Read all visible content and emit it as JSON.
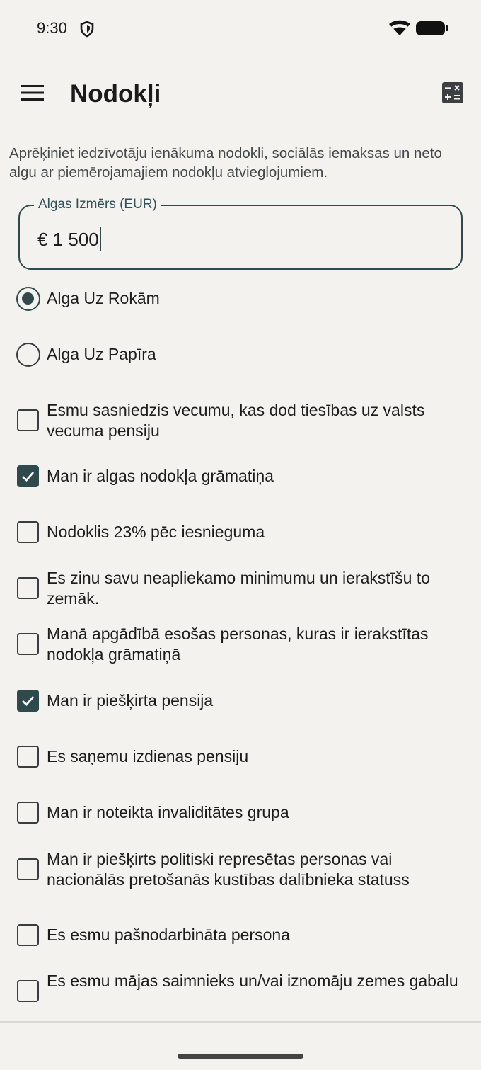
{
  "status_bar": {
    "time": "9:30"
  },
  "app_bar": {
    "title": "Nodokļi"
  },
  "description": "Aprēķiniet iedzīvotāju ienākuma nodokli, sociālās iemaksas un neto algu ar piemērojamajiem nodokļu atvieglojumiem.",
  "salary_field": {
    "label": "Algas Izmērs (EUR)",
    "value": "€ 1 500"
  },
  "radio_options": [
    {
      "label": "Alga Uz Rokām",
      "selected": true
    },
    {
      "label": "Alga Uz Papīra",
      "selected": false
    }
  ],
  "checkbox_options": [
    {
      "label": "Esmu sasniedzis vecumu, kas dod tiesības uz valsts vecuma pensiju",
      "checked": false
    },
    {
      "label": "Man ir algas nodokļa grāmatiņa",
      "checked": true
    },
    {
      "label": "Nodoklis 23% pēc iesnieguma",
      "checked": false
    },
    {
      "label": "Es zinu savu neapliekamo minimumu un ierakstīšu to zemāk.",
      "checked": false
    },
    {
      "label": "Manā apgādībā esošas personas, kuras ir ierakstītas nodokļa grāmatiņā",
      "checked": false
    },
    {
      "label": "Man ir piešķirta pensija",
      "checked": true
    },
    {
      "label": "Es saņemu izdienas pensiju",
      "checked": false
    },
    {
      "label": "Man ir noteikta invaliditātes grupa",
      "checked": false
    },
    {
      "label": "Man ir piešķirts politiski represētas personas vai nacionālās pretošanās kustības dalībnieka statuss",
      "checked": false
    },
    {
      "label": "Es esmu pašnodarbināta persona",
      "checked": false
    },
    {
      "label": "Es esmu mājas saimnieks un/vai iznomāju zemes gabalu",
      "checked": false
    }
  ],
  "colors": {
    "accent": "#2e4a4c",
    "background": "#f3f2ef"
  }
}
